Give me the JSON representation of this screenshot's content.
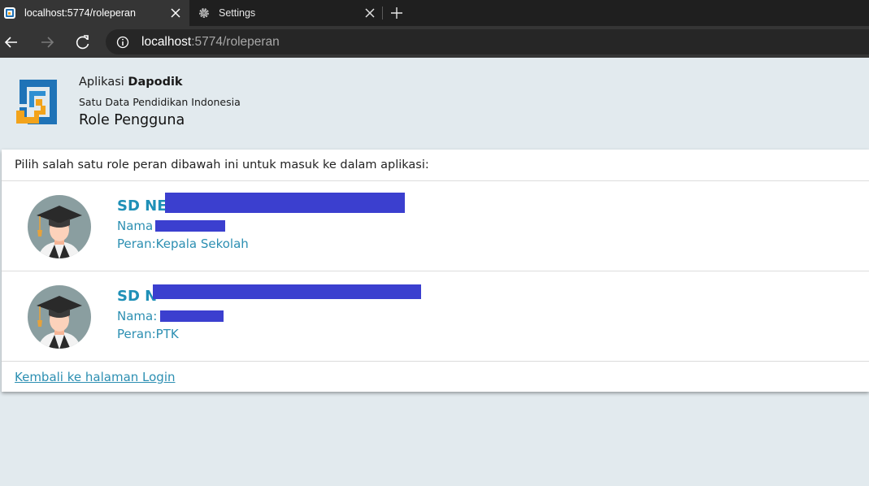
{
  "browser": {
    "tabs": [
      {
        "title": "localhost:5774/roleperan",
        "active": true
      },
      {
        "title": "Settings",
        "active": false
      }
    ],
    "url": {
      "host": "localhost",
      "rest": ":5774/roleperan"
    }
  },
  "header": {
    "app_prefix": "Aplikasi",
    "app_name": "Dapodik",
    "subtitle": "Satu Data Pendidikan Indonesia",
    "page_title": "Role Pengguna"
  },
  "card": {
    "instruction": "Pilih salah satu role peran dibawah ini untuk masuk ke dalam aplikasi:",
    "roles": [
      {
        "school": "SD NE",
        "name_label": "Nama",
        "role_label": "Peran:",
        "role": "Kepala Sekolah"
      },
      {
        "school": "SD N",
        "name_label": "Nama:",
        "role_label": "Peran:",
        "role": "PTK"
      }
    ],
    "back_link": "Kembali ke halaman Login"
  },
  "colors": {
    "accent": "#2c8fb2",
    "redaction": "#3b3fcf",
    "page_background": "#e2eaee"
  },
  "icons": [
    "dapodik-favicon",
    "close-icon",
    "gear-icon",
    "plus-icon",
    "back-arrow-icon",
    "forward-arrow-icon",
    "refresh-icon",
    "info-icon",
    "dapodik-logo",
    "graduate-avatar-icon"
  ]
}
